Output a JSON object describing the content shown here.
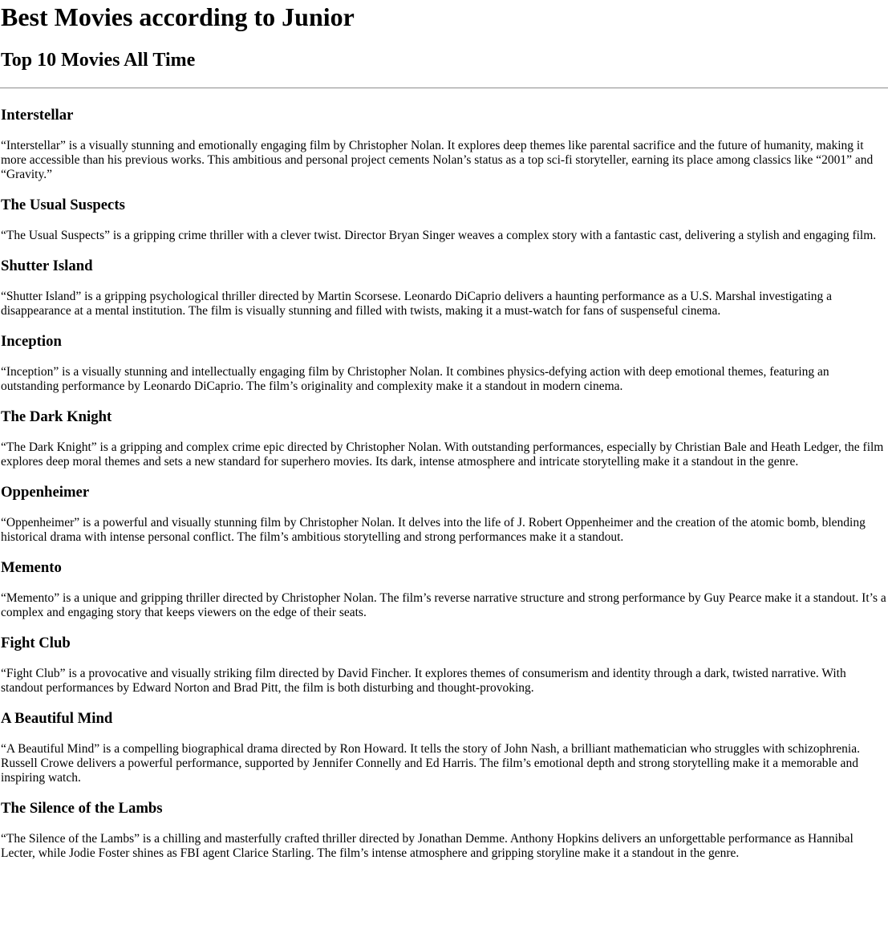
{
  "page": {
    "title": "Best Movies according to Junior",
    "subtitle": "Top 10 Movies All Time"
  },
  "movies": [
    {
      "title": "Interstellar",
      "review": "“Interstellar” is a visually stunning and emotionally engaging film by Christopher Nolan. It explores deep themes like parental sacrifice and the future of humanity, making it more accessible than his previous works. This ambitious and personal project cements Nolan’s status as a top sci-fi storyteller, earning its place among classics like “2001” and “Gravity.”"
    },
    {
      "title": "The Usual Suspects",
      "review": "“The Usual Suspects” is a gripping crime thriller with a clever twist. Director Bryan Singer weaves a complex story with a fantastic cast, delivering a stylish and engaging film."
    },
    {
      "title": "Shutter Island",
      "review": "“Shutter Island” is a gripping psychological thriller directed by Martin Scorsese. Leonardo DiCaprio delivers a haunting performance as a U.S. Marshal investigating a disappearance at a mental institution. The film is visually stunning and filled with twists, making it a must-watch for fans of suspenseful cinema."
    },
    {
      "title": "Inception",
      "review": "“Inception” is a visually stunning and intellectually engaging film by Christopher Nolan. It combines physics-defying action with deep emotional themes, featuring an outstanding performance by Leonardo DiCaprio. The film’s originality and complexity make it a standout in modern cinema."
    },
    {
      "title": "The Dark Knight",
      "review": "“The Dark Knight” is a gripping and complex crime epic directed by Christopher Nolan. With outstanding performances, especially by Christian Bale and Heath Ledger, the film explores deep moral themes and sets a new standard for superhero movies. Its dark, intense atmosphere and intricate storytelling make it a standout in the genre."
    },
    {
      "title": "Oppenheimer",
      "review": "“Oppenheimer” is a powerful and visually stunning film by Christopher Nolan. It delves into the life of J. Robert Oppenheimer and the creation of the atomic bomb, blending historical drama with intense personal conflict. The film’s ambitious storytelling and strong performances make it a standout."
    },
    {
      "title": "Memento",
      "review": "“Memento” is a unique and gripping thriller directed by Christopher Nolan. The film’s reverse narrative structure and strong performance by Guy Pearce make it a standout. It’s a complex and engaging story that keeps viewers on the edge of their seats."
    },
    {
      "title": "Fight Club",
      "review": "“Fight Club” is a provocative and visually striking film directed by David Fincher. It explores themes of consumerism and identity through a dark, twisted narrative. With standout performances by Edward Norton and Brad Pitt, the film is both disturbing and thought-provoking."
    },
    {
      "title": "A Beautiful Mind",
      "review": "“A Beautiful Mind” is a compelling biographical drama directed by Ron Howard. It tells the story of John Nash, a brilliant mathematician who struggles with schizophrenia. Russell Crowe delivers a powerful performance, supported by Jennifer Connelly and Ed Harris. The film’s emotional depth and strong storytelling make it a memorable and inspiring watch."
    },
    {
      "title": "The Silence of the Lambs",
      "review": "“The Silence of the Lambs” is a chilling and masterfully crafted thriller directed by Jonathan Demme. Anthony Hopkins delivers an unforgettable performance as Hannibal Lecter, while Jodie Foster shines as FBI agent Clarice Starling. The film’s intense atmosphere and gripping storyline make it a standout in the genre."
    }
  ]
}
